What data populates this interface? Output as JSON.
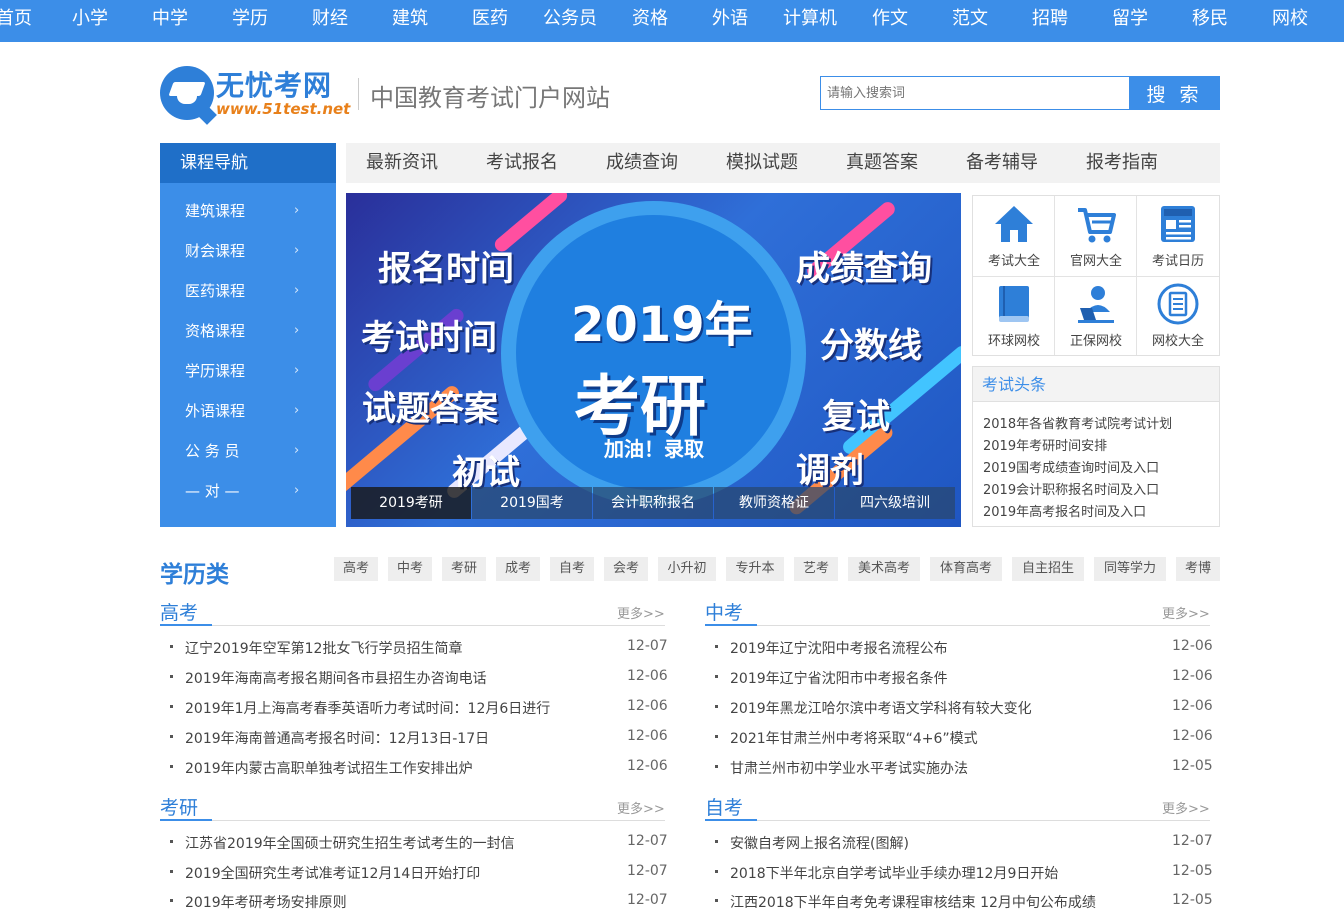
{
  "topnav": [
    "首页",
    "小学",
    "中学",
    "学历",
    "财经",
    "建筑",
    "医药",
    "公务员",
    "资格",
    "外语",
    "计算机",
    "作文",
    "范文",
    "招聘",
    "留学",
    "移民",
    "网校"
  ],
  "header": {
    "logo_name": "无忧考网",
    "logo_url": "www.51test.net",
    "slogan": "中国教育考试门户网站",
    "search_placeholder": "请输入搜索词",
    "search_button": "搜 索"
  },
  "course_nav": {
    "title": "课程导航",
    "items": [
      "建筑课程",
      "财会课程",
      "医药课程",
      "资格课程",
      "学历课程",
      "外语课程",
      "公 务 员",
      "— 对 —"
    ]
  },
  "main_tabs": [
    "最新资讯",
    "考试报名",
    "成绩查询",
    "模拟试题",
    "真题答案",
    "备考辅导",
    "报考指南"
  ],
  "banner": {
    "words": [
      "报名时间",
      "成绩查询",
      "考试时间",
      "分数线",
      "试题答案",
      "复试",
      "初试",
      "调剂"
    ],
    "year": "2019年",
    "exam": "考研",
    "cheer": "加油！录取",
    "tabs": [
      "2019考研",
      "2019国考",
      "会计职称报名",
      "教师资格证",
      "四六级培训"
    ]
  },
  "quick_links": [
    {
      "label": "考试大全",
      "icon": "home-icon"
    },
    {
      "label": "官网大全",
      "icon": "cart-icon"
    },
    {
      "label": "考试日历",
      "icon": "news-icon"
    },
    {
      "label": "环球网校",
      "icon": "book-icon"
    },
    {
      "label": "正保网校",
      "icon": "person-laptop-icon"
    },
    {
      "label": "网校大全",
      "icon": "document-icon"
    }
  ],
  "headlines": {
    "title": "考试头条",
    "items": [
      "2018年各省教育考试院考试计划",
      "2019年考研时间安排",
      "2019国考成绩查询时间及入口",
      "2019会计职称报名时间及入口",
      "2019年高考报名时间及入口"
    ]
  },
  "section": {
    "title": "学历类",
    "tags": [
      "高考",
      "中考",
      "考研",
      "成考",
      "自考",
      "会考",
      "小升初",
      "专升本",
      "艺考",
      "美术高考",
      "体育高考",
      "自主招生",
      "同等学力",
      "考博"
    ]
  },
  "columns": [
    {
      "title": "高考",
      "more": "更多>>",
      "items": [
        {
          "text": "辽宁2019年空军第12批女飞行学员招生简章",
          "date": "12-07"
        },
        {
          "text": "2019年海南高考报名期间各市县招生办咨询电话",
          "date": "12-06"
        },
        {
          "text": "2019年1月上海高考春季英语听力考试时间：12月6日进行",
          "date": "12-06"
        },
        {
          "text": "2019年海南普通高考报名时间：12月13日-17日",
          "date": "12-06"
        },
        {
          "text": "2019年内蒙古高职单独考试招生工作安排出炉",
          "date": "12-06"
        }
      ]
    },
    {
      "title": "中考",
      "more": "更多>>",
      "items": [
        {
          "text": "2019年辽宁沈阳中考报名流程公布",
          "date": "12-06"
        },
        {
          "text": "2019年辽宁省沈阳市中考报名条件",
          "date": "12-06"
        },
        {
          "text": "2019年黑龙江哈尔滨中考语文学科将有较大变化",
          "date": "12-06"
        },
        {
          "text": "2021年甘肃兰州中考将采取“4+6”模式",
          "date": "12-06"
        },
        {
          "text": "甘肃兰州市初中学业水平考试实施办法",
          "date": "12-05"
        }
      ]
    },
    {
      "title": "考研",
      "more": "更多>>",
      "items": [
        {
          "text": "江苏省2019年全国硕士研究生招生考试考生的一封信",
          "date": "12-07"
        },
        {
          "text": "2019全国研究生考试准考证12月14日开始打印",
          "date": "12-07"
        },
        {
          "text": "2019年考研考场安排原则",
          "date": "12-07"
        }
      ]
    },
    {
      "title": "自考",
      "more": "更多>>",
      "items": [
        {
          "text": "安徽自考网上报名流程(图解)",
          "date": "12-07"
        },
        {
          "text": "2018下半年北京自学考试毕业手续办理12月9日开始",
          "date": "12-05"
        },
        {
          "text": "江西2018下半年自考免考课程审核结束 12月中旬公布成绩",
          "date": "12-05"
        }
      ]
    }
  ]
}
